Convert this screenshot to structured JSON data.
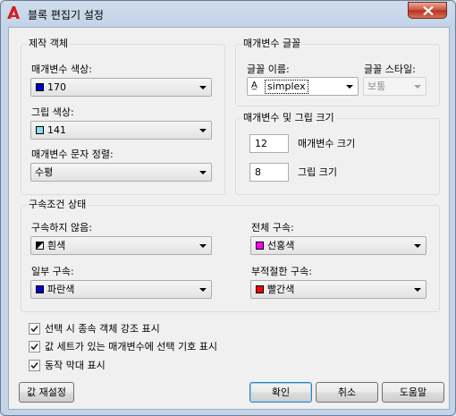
{
  "window": {
    "title": "블록 편집기 설정"
  },
  "object_group": {
    "title": "제작 객체",
    "param_color": {
      "label": "매개변수 색상:",
      "value": "170",
      "color": "#0000cc"
    },
    "grip_color": {
      "label": "그립 색상:",
      "value": "141",
      "color": "#8fd8f0"
    },
    "text_align": {
      "label": "매개변수 문자 정렬:",
      "value": "수평"
    }
  },
  "font_group": {
    "title": "매개변수 글꼴",
    "font_name": {
      "label": "글꼴 이름:",
      "value": "simplex"
    },
    "font_style": {
      "label": "글꼴 스타일:",
      "value": "보통"
    }
  },
  "size_group": {
    "title": "매개변수 및 그립 크기",
    "param_size": {
      "value": "12",
      "label": "매개변수 크기"
    },
    "grip_size": {
      "value": "8",
      "label": "그립 크기"
    }
  },
  "constraint_group": {
    "title": "구속조건 상태",
    "unconstrained": {
      "label": "구속하지 않음:",
      "value": "흰색",
      "color": "#ffffff"
    },
    "fully": {
      "label": "전체 구속:",
      "value": "선홍색",
      "color": "#ff00ff"
    },
    "partially": {
      "label": "일부 구속:",
      "value": "파란색",
      "color": "#0000cc"
    },
    "improper": {
      "label": "부적절한 구속:",
      "value": "빨간색",
      "color": "#ff0000"
    }
  },
  "checkboxes": [
    {
      "label": "선택 시 종속 객체 강조 표시",
      "checked": true
    },
    {
      "label": "값 세트가 있는 매개변수에 선택 기호 표시",
      "checked": true
    },
    {
      "label": "동작 막대 표시",
      "checked": true
    }
  ],
  "buttons": {
    "reset": "값 재설정",
    "ok": "확인",
    "cancel": "취소",
    "help": "도움말"
  }
}
